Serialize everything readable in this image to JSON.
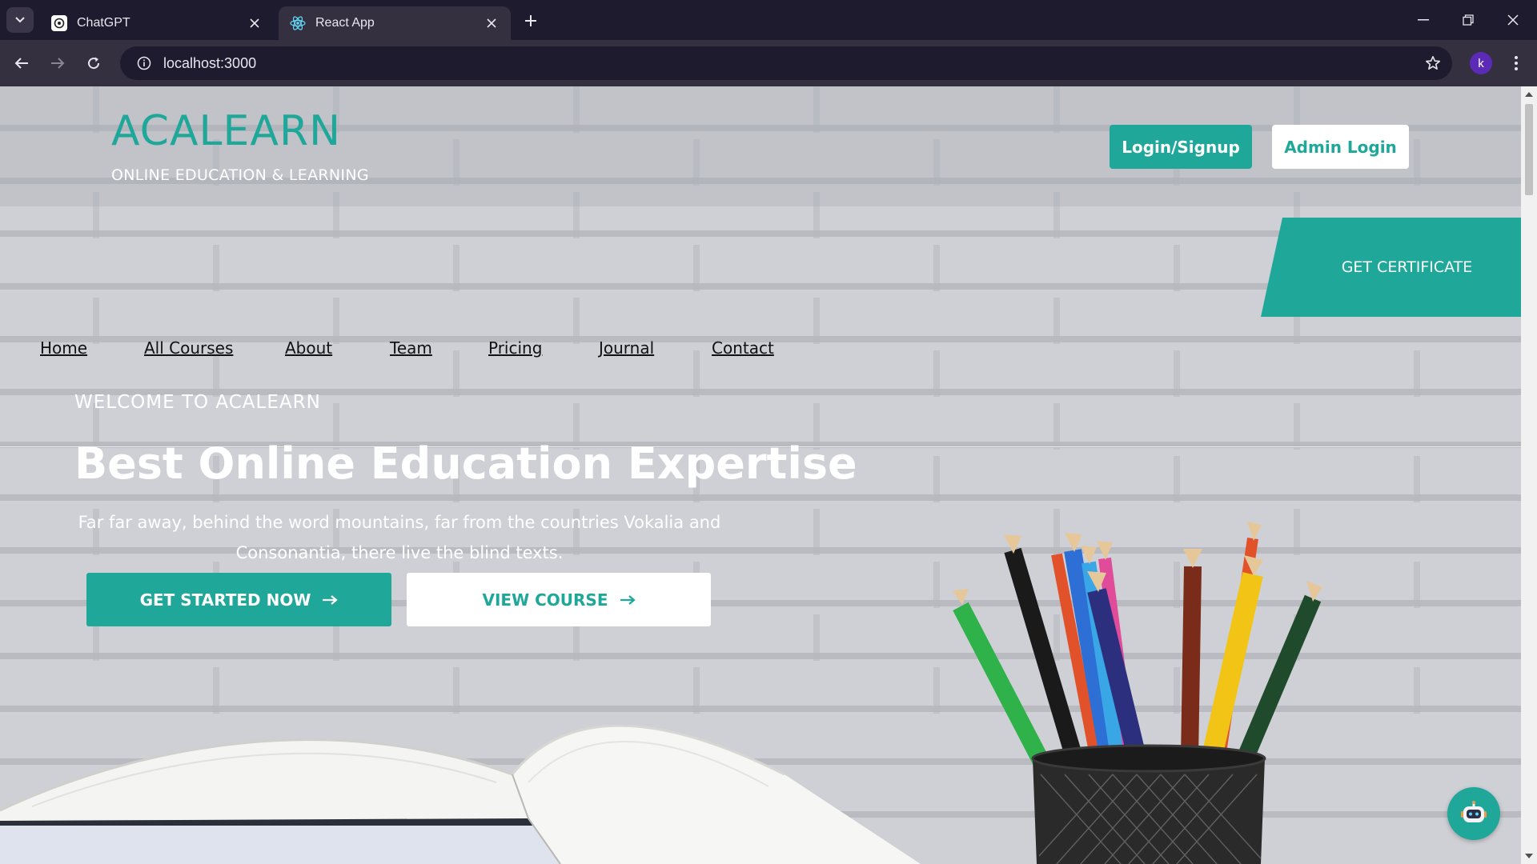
{
  "browser": {
    "tabs": [
      {
        "title": "ChatGPT",
        "icon": "chatgpt-favicon-icon"
      },
      {
        "title": "React App",
        "icon": "react-favicon-icon"
      }
    ],
    "url": "localhost:3000",
    "profile_initial": "k"
  },
  "header": {
    "brand": "ACALEARN",
    "tagline": "ONLINE EDUCATION & LEARNING",
    "login_button": "Login/Signup",
    "admin_button": "Admin Login"
  },
  "nav": {
    "items": [
      "Home",
      "All Courses",
      "About",
      "Team",
      "Pricing",
      "Journal",
      "Contact"
    ],
    "cta": "GET CERTIFICATE"
  },
  "hero": {
    "welcome": "WELCOME TO ACALEARN",
    "headline": "Best Online Education Expertise",
    "lead": "Far far away, behind the word mountains, far from the countries Vokalia and Consonantia, there live the blind texts.",
    "primary_button": "GET STARTED NOW",
    "secondary_button": "VIEW COURSE"
  },
  "colors": {
    "accent": "#1fa799",
    "chrome_dark": "#1f1b2e",
    "chrome_toolbar": "#35303f"
  }
}
